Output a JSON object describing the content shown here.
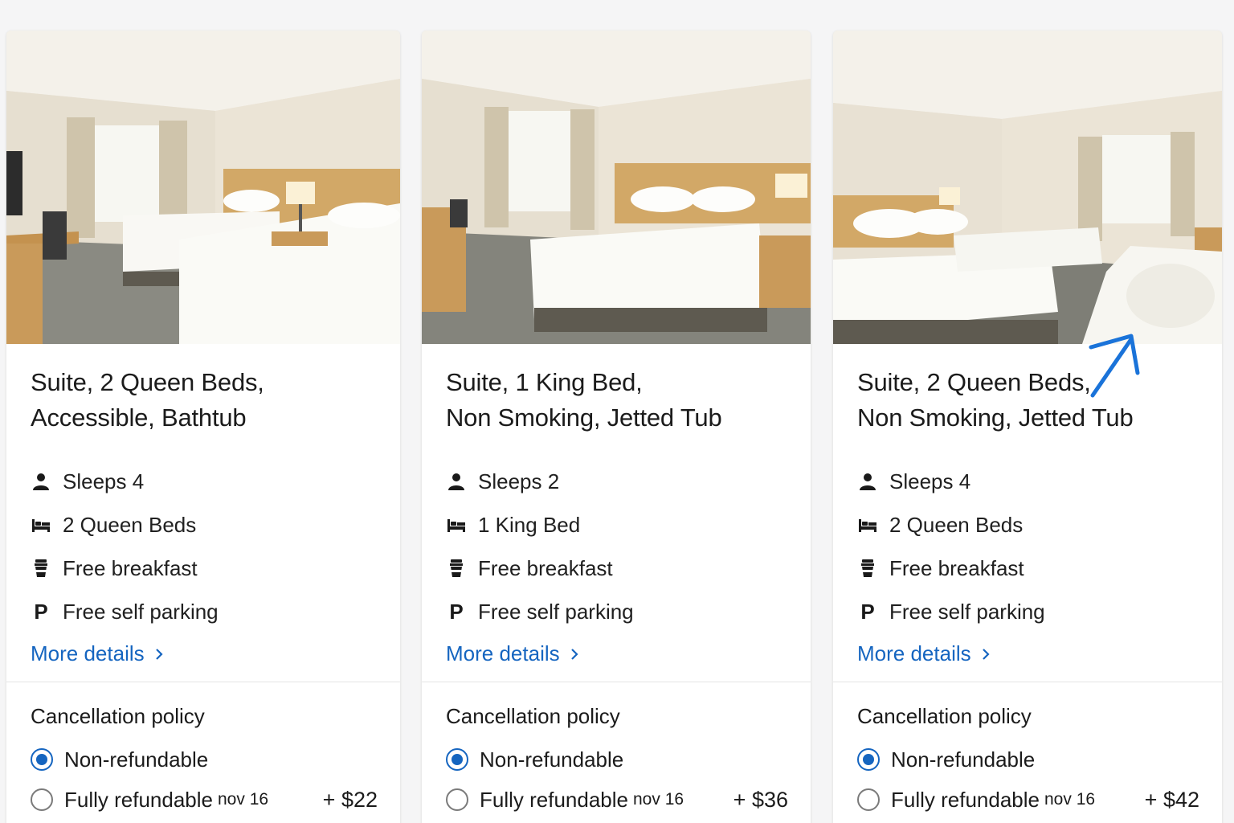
{
  "colors": {
    "link": "#1565c0",
    "annotation": "#1a73d9",
    "text": "#1b1b1b"
  },
  "rooms": [
    {
      "title_line1": "Suite, 2 Queen Beds,",
      "title_line2": "Accessible, Bathtub",
      "features": [
        {
          "icon": "person-icon",
          "label": "Sleeps 4"
        },
        {
          "icon": "bed-icon",
          "label": "2 Queen Beds"
        },
        {
          "icon": "coffee-cup-icon",
          "label": "Free breakfast"
        },
        {
          "icon": "parking-icon",
          "label": "Free self parking"
        }
      ],
      "more_details": "More details",
      "cancellation": {
        "title": "Cancellation policy",
        "options": [
          {
            "label": "Non-refundable",
            "date": "",
            "price": "",
            "selected": true
          },
          {
            "label": "Fully refundable",
            "date": "nov 16",
            "price": "+ $22",
            "selected": false
          }
        ]
      }
    },
    {
      "title_line1": "Suite, 1 King Bed,",
      "title_line2": "Non Smoking, Jetted Tub",
      "features": [
        {
          "icon": "person-icon",
          "label": "Sleeps 2"
        },
        {
          "icon": "bed-icon",
          "label": "1 King Bed"
        },
        {
          "icon": "coffee-cup-icon",
          "label": "Free breakfast"
        },
        {
          "icon": "parking-icon",
          "label": "Free self parking"
        }
      ],
      "more_details": "More details",
      "cancellation": {
        "title": "Cancellation policy",
        "options": [
          {
            "label": "Non-refundable",
            "date": "",
            "price": "",
            "selected": true
          },
          {
            "label": "Fully refundable",
            "date": "nov 16",
            "price": "+ $36",
            "selected": false
          }
        ]
      }
    },
    {
      "title_line1": "Suite, 2 Queen Beds,",
      "title_line2": "Non Smoking, Jetted Tub",
      "features": [
        {
          "icon": "person-icon",
          "label": "Sleeps 4"
        },
        {
          "icon": "bed-icon",
          "label": "2 Queen Beds"
        },
        {
          "icon": "coffee-cup-icon",
          "label": "Free breakfast"
        },
        {
          "icon": "parking-icon",
          "label": "Free self parking"
        }
      ],
      "more_details": "More details",
      "cancellation": {
        "title": "Cancellation policy",
        "options": [
          {
            "label": "Non-refundable",
            "date": "",
            "price": "",
            "selected": true
          },
          {
            "label": "Fully refundable",
            "date": "nov 16",
            "price": "+ $42",
            "selected": false
          }
        ]
      }
    }
  ]
}
